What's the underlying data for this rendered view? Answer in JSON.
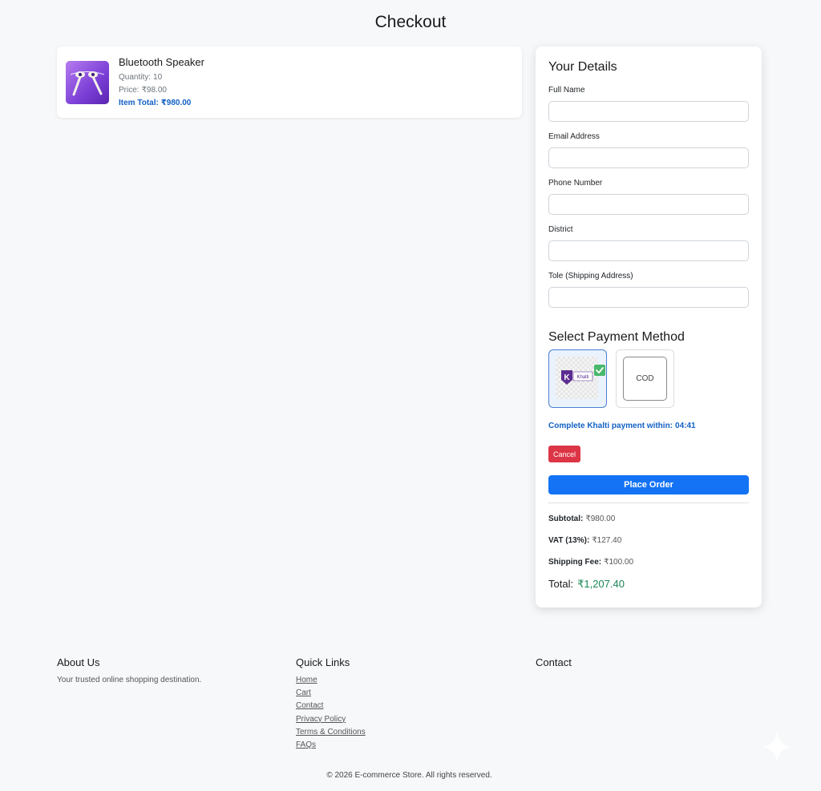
{
  "page": {
    "title": "Checkout"
  },
  "cart_items": [
    {
      "name": "Bluetooth Speaker",
      "quantity_label": "Quantity:",
      "quantity": "10",
      "price_label": "Price:",
      "price": "₹98.00",
      "item_total_label": "Item Total:",
      "item_total": "₹980.00",
      "image_icon": "earphones-product-image"
    }
  ],
  "details_form": {
    "heading": "Your Details",
    "fields": [
      {
        "label": "Full Name",
        "value": "",
        "placeholder": ""
      },
      {
        "label": "Email Address",
        "value": "",
        "placeholder": ""
      },
      {
        "label": "Phone Number",
        "value": "",
        "placeholder": ""
      },
      {
        "label": "District",
        "value": "",
        "placeholder": ""
      },
      {
        "label": "Tole (Shipping Address)",
        "value": "",
        "placeholder": ""
      }
    ]
  },
  "payment": {
    "heading": "Select Payment Method",
    "options": [
      {
        "name": "Khalti",
        "logo_text": "Khalti",
        "logo_letter": "K",
        "selected": true,
        "icon": "checkmark-icon"
      },
      {
        "name": "COD",
        "label": "COD",
        "selected": false
      }
    ],
    "timer_label": "Complete Khalti payment within:",
    "timer_value": "04:41",
    "cancel_label": "Cancel",
    "place_order_label": "Place Order"
  },
  "summary": {
    "subtotal_label": "Subtotal:",
    "subtotal": "₹980.00",
    "vat_label": "VAT (13%):",
    "vat": "₹127.40",
    "shipping_label": "Shipping Fee:",
    "shipping": "₹100.00",
    "total_label": "Total:",
    "total": "₹1,207.40"
  },
  "footer": {
    "about": {
      "heading": "About Us",
      "text": "Your trusted online shopping destination."
    },
    "quick_links": {
      "heading": "Quick Links",
      "links": [
        "Home",
        "Cart",
        "Contact",
        "Privacy Policy",
        "Terms & Conditions",
        "FAQs"
      ]
    },
    "contact": {
      "heading": "Contact"
    },
    "copyright": "© 2026 E-commerce Store. All rights reserved."
  },
  "colors": {
    "accent_blue": "#1473f5",
    "cancel_red": "#dc3545",
    "total_green": "#198754",
    "link_blue": "#1261c4",
    "khalti_purple": "#5c2d91"
  }
}
